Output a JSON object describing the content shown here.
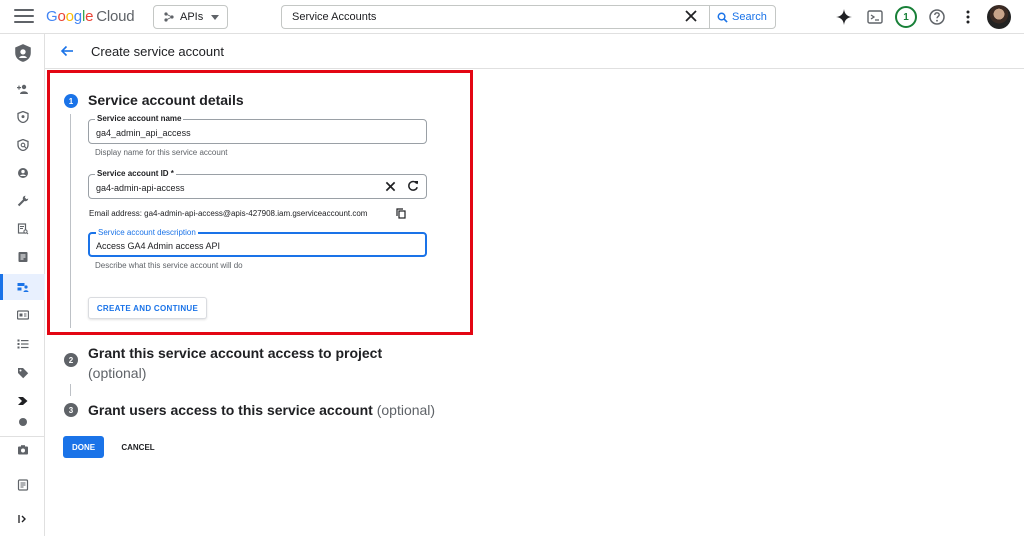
{
  "topbar": {
    "logo_parts": [
      "G",
      "o",
      "o",
      "g",
      "l",
      "e"
    ],
    "logo_suffix": "Cloud",
    "project": "APIs",
    "search_value": "Service Accounts",
    "search_button": "Search",
    "notification_count": "1"
  },
  "header": {
    "title": "Create service account"
  },
  "steps": [
    {
      "number": "1",
      "title": "Service account details"
    },
    {
      "number": "2",
      "title": "Grant this service account access to project",
      "optional": "(optional)"
    },
    {
      "number": "3",
      "title": "Grant users access to this service account",
      "optional": "(optional)"
    }
  ],
  "form": {
    "name_label": "Service account name",
    "name_value": "ga4_admin_api_access",
    "name_hint": "Display name for this service account",
    "id_label": "Service account ID *",
    "id_value": "ga4-admin-api-access",
    "email_line": "Email address: ga4-admin-api-access@apis-427908.iam.gserviceaccount.com",
    "desc_label": "Service account description",
    "desc_value": "Access GA4 Admin access API",
    "desc_hint": "Describe what this service account will do",
    "create_button": "CREATE AND CONTINUE"
  },
  "footer": {
    "done": "DONE",
    "cancel": "CANCEL"
  },
  "colors": {
    "accent": "#1a73e8",
    "highlight": "#e30613",
    "badge": "#188038"
  }
}
